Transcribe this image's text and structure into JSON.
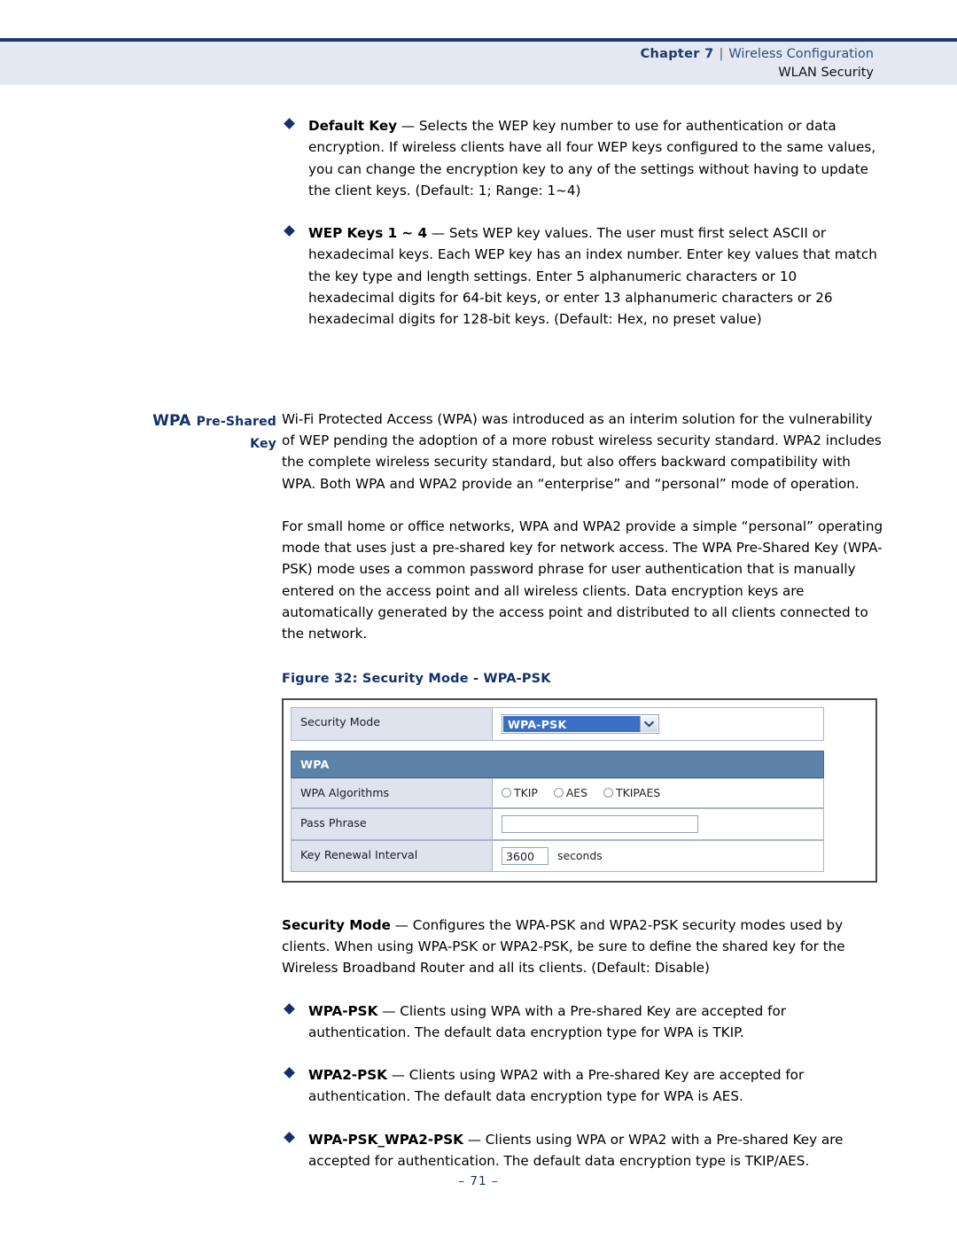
{
  "header": {
    "chapter_label": "Chapter",
    "chapter_number": "7",
    "separator": "|",
    "chapter_title": "Wireless Configuration",
    "subtitle": "WLAN Security"
  },
  "bullets_top": [
    {
      "term": "Default Key",
      "dash": " — ",
      "text": "Selects the WEP key number to use for authentication or data encryption. If wireless clients have all four WEP keys configured to the same values, you can change the encryption key to any of the settings without having to update the client keys. (Default: 1; Range: 1~4)"
    },
    {
      "term": "WEP Keys 1 ~ 4",
      "dash": " — ",
      "text": "Sets WEP key values. The user must first select ASCII or hexadecimal keys. Each WEP key has an index number. Enter key values that match the key type and length settings. Enter 5 alphanumeric characters or 10 hexadecimal digits for 64-bit keys, or enter 13 alphanumeric characters or 26 hexadecimal digits for 128-bit keys. (Default: Hex, no preset value)"
    }
  ],
  "side_section": {
    "heading_line1_first": "WPA",
    "heading_line1_rest": "Pre-Shared",
    "heading_line2": "Key",
    "paragraph1": "Wi-Fi Protected Access (WPA) was introduced as an interim solution for the vulnerability of WEP pending the adoption of a more robust wireless security standard. WPA2 includes the complete wireless security standard, but also offers backward compatibility with WPA. Both WPA and WPA2 provide an “enterprise” and “personal” mode of operation.",
    "paragraph2": "For small home or office networks, WPA and WPA2 provide a simple “personal” operating mode that uses just a pre-shared key for network access. The WPA Pre-Shared Key (WPA-PSK) mode uses a common password phrase for user authentication that is manually entered on the access point and all wireless clients. Data encryption keys are automatically generated by the access point and distributed to all clients connected to the network."
  },
  "figure": {
    "caption": "Figure 32:  Security Mode - WPA-PSK",
    "rows": {
      "security_mode_label": "Security Mode",
      "security_mode_value": "WPA-PSK",
      "section_bar": "WPA",
      "wpa_algorithms_label": "WPA Algorithms",
      "radios": [
        {
          "label": "TKIP",
          "selected": false
        },
        {
          "label": "AES",
          "selected": false
        },
        {
          "label": "TKIPAES",
          "selected": false
        }
      ],
      "pass_phrase_label": "Pass Phrase",
      "pass_phrase_value": "",
      "key_renewal_label": "Key Renewal Interval",
      "key_renewal_value": "3600",
      "key_renewal_unit": "seconds"
    }
  },
  "security_mode_block": {
    "term": "Security Mode",
    "dash": " — ",
    "text": "Configures the WPA-PSK and WPA2-PSK security modes used by clients. When using WPA-PSK or WPA2-PSK, be sure to define the shared key for the Wireless Broadband Router and all its clients. (Default: Disable)"
  },
  "bullets_bottom": [
    {
      "term": "WPA-PSK",
      "dash": " — ",
      "text": "Clients using WPA with a Pre-shared Key are accepted for authentication. The default data encryption type for WPA is TKIP."
    },
    {
      "term": "WPA2-PSK",
      "dash": " — ",
      "text": "Clients using WPA2 with a Pre-shared Key are accepted for authentication. The default data encryption type for WPA is AES."
    },
    {
      "term": "WPA-PSK_WPA2-PSK",
      "dash": " — ",
      "text": "Clients using WPA or WPA2 with a Pre-shared Key are accepted for authentication. The default data encryption type is TKIP/AES."
    }
  ],
  "footer": {
    "page_number": "–  71  –"
  },
  "colors": {
    "navy": "#12306b",
    "header_band": "#e4e8f2",
    "select_highlight": "#3b6fc4",
    "section_bar": "#5b82a8",
    "label_cell": "#dfe3ed"
  }
}
